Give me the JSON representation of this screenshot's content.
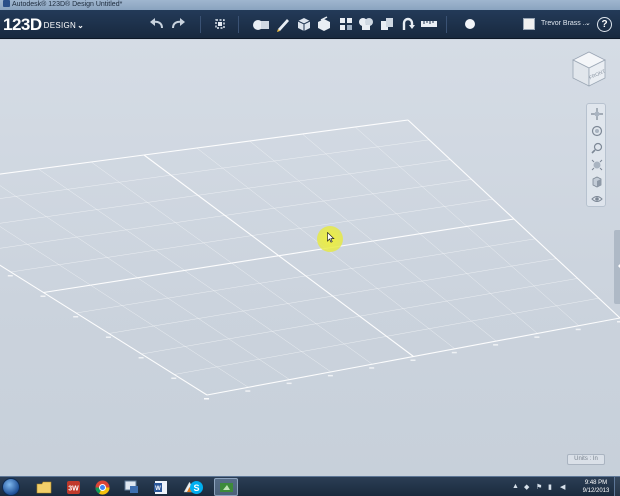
{
  "window": {
    "title": "Autodesk® 123D® Design Untitled*"
  },
  "toolbar": {
    "logo_main": "123D",
    "logo_sub": "DESIGN",
    "logo_caret": "⌄",
    "buttons": [
      {
        "name": "undo-icon",
        "glyph": "undo"
      },
      {
        "name": "redo-icon",
        "glyph": "redo"
      },
      {
        "name": "transform-icon",
        "glyph": "transform"
      },
      {
        "name": "primitives-icon",
        "glyph": "primitives"
      },
      {
        "name": "sketch-icon",
        "glyph": "sketch"
      },
      {
        "name": "construct-icon",
        "glyph": "construct"
      },
      {
        "name": "modify-icon",
        "glyph": "modify"
      },
      {
        "name": "pattern-icon",
        "glyph": "pattern"
      },
      {
        "name": "grouping-icon",
        "glyph": "grouping"
      },
      {
        "name": "combine-icon",
        "glyph": "combine"
      },
      {
        "name": "snap-icon",
        "glyph": "snap"
      },
      {
        "name": "measure-icon",
        "glyph": "measure"
      },
      {
        "name": "material-icon",
        "glyph": "material"
      }
    ],
    "user_name": "Trevor Brass ...",
    "user_caret": "⌄",
    "help": "?"
  },
  "viewport": {
    "viewcube_face": "FRONT",
    "nav_tools": [
      "pan",
      "orbit",
      "zoom",
      "fit",
      "view-mode",
      "visibility"
    ],
    "units_label": "Units : In",
    "highlight_color": "#eeee44"
  },
  "taskbar": {
    "apps": [
      {
        "name": "taskbar-explorer",
        "label": "Windows Explorer"
      },
      {
        "name": "taskbar-sketchup",
        "label": "SketchUp"
      },
      {
        "name": "taskbar-chrome",
        "label": "Google Chrome"
      },
      {
        "name": "taskbar-remote",
        "label": "Remote Desktop"
      },
      {
        "name": "taskbar-word",
        "label": "Microsoft Word"
      },
      {
        "name": "taskbar-fusion",
        "label": "Autodesk"
      },
      {
        "name": "taskbar-skype",
        "label": "Skype"
      },
      {
        "name": "taskbar-123d",
        "label": "123D Design"
      }
    ],
    "time": "9:48 PM",
    "date": "9/12/2013"
  },
  "colors": {
    "toolbar_bg": "#1f3450",
    "viewport_bg": "#cdd5df",
    "grid_line": "#ffffff",
    "taskbar_bg": "#22354b"
  }
}
